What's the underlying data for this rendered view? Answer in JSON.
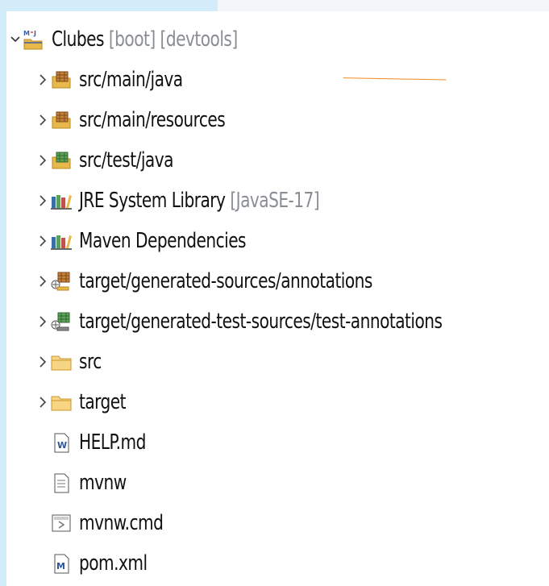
{
  "tree": {
    "project": {
      "label": "Clubes",
      "decoration": "[boot] [devtools]",
      "icon": "maven-project-icon"
    },
    "items": [
      {
        "label": "src/main/java",
        "decoration": "",
        "icon": "source-package-icon",
        "expandable": true
      },
      {
        "label": "src/main/resources",
        "decoration": "",
        "icon": "source-package-icon",
        "expandable": true
      },
      {
        "label": "src/test/java",
        "decoration": "",
        "icon": "test-package-icon",
        "expandable": true
      },
      {
        "label": "JRE System Library",
        "decoration": "[JavaSE-17]",
        "icon": "library-icon",
        "expandable": true
      },
      {
        "label": "Maven Dependencies",
        "decoration": "",
        "icon": "library-icon",
        "expandable": true
      },
      {
        "label": "target/generated-sources/annotations",
        "decoration": "",
        "icon": "generated-source-icon",
        "expandable": true
      },
      {
        "label": "target/generated-test-sources/test-annotations",
        "decoration": "",
        "icon": "generated-test-source-icon",
        "expandable": true
      },
      {
        "label": "src",
        "decoration": "",
        "icon": "folder-icon",
        "expandable": true
      },
      {
        "label": "target",
        "decoration": "",
        "icon": "folder-icon",
        "expandable": true
      },
      {
        "label": "HELP.md",
        "decoration": "",
        "icon": "markdown-file-icon",
        "expandable": false
      },
      {
        "label": "mvnw",
        "decoration": "",
        "icon": "text-file-icon",
        "expandable": false
      },
      {
        "label": "mvnw.cmd",
        "decoration": "",
        "icon": "cmd-file-icon",
        "expandable": false
      },
      {
        "label": "pom.xml",
        "decoration": "",
        "icon": "maven-pom-icon",
        "expandable": false
      }
    ]
  },
  "colors": {
    "accent_arrow": "#f08a24",
    "decoration": "#8a8e94",
    "folder": "#e8b84a"
  }
}
